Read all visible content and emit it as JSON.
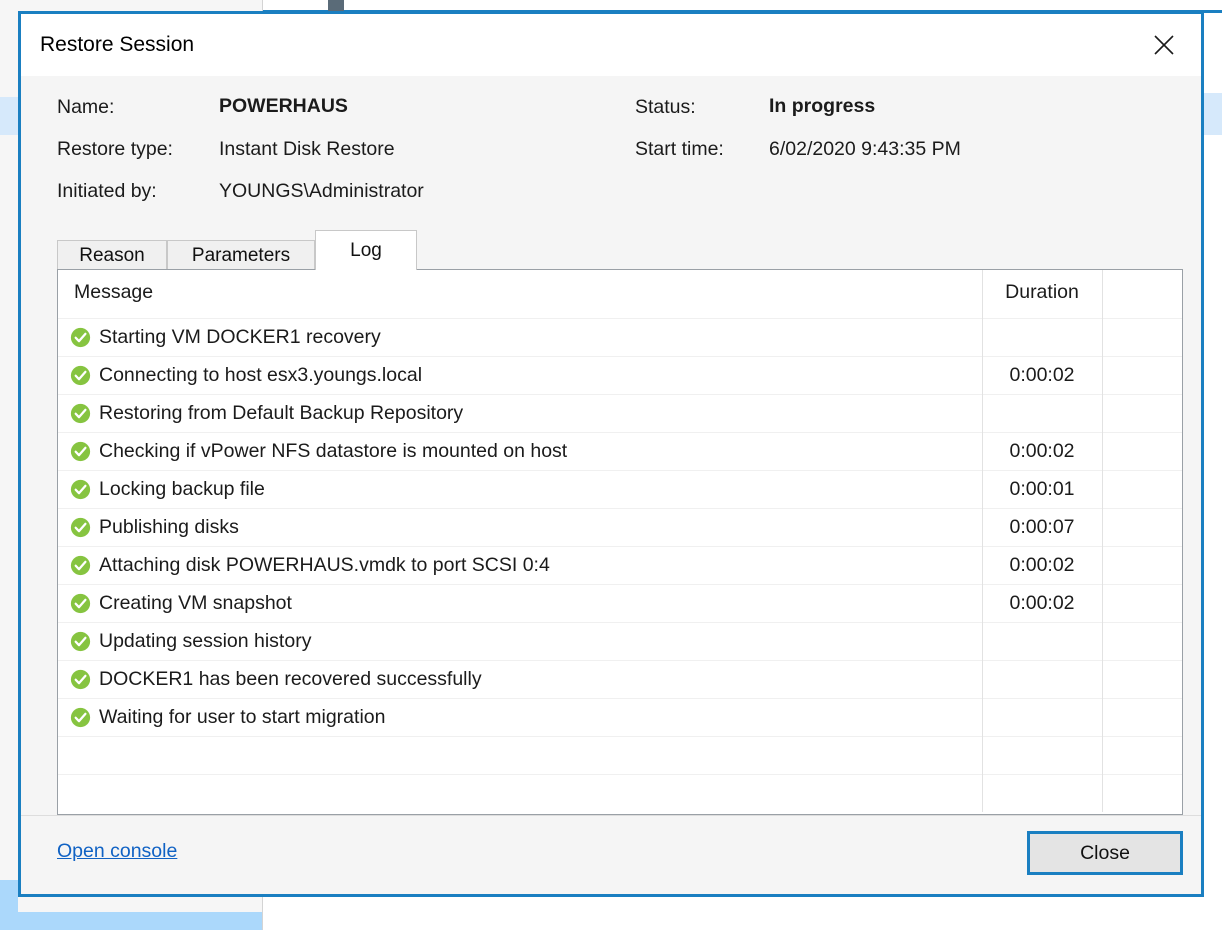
{
  "dialog": {
    "title": "Restore Session",
    "close_icon": "close-icon"
  },
  "summary": {
    "fields": [
      {
        "label": "Name:",
        "value": "POWERHAUS",
        "bold": true
      },
      {
        "label": "Restore type:",
        "value": "Instant Disk Restore",
        "bold": false
      },
      {
        "label": "Initiated by:",
        "value": "YOUNGS\\Administrator",
        "bold": false
      },
      {
        "label": "Status:",
        "value": "In progress",
        "bold": true
      },
      {
        "label": "Start time:",
        "value": "6/02/2020 9:43:35 PM",
        "bold": false
      }
    ]
  },
  "tabs": [
    {
      "label": "Reason",
      "selected": false
    },
    {
      "label": "Parameters",
      "selected": false
    },
    {
      "label": "Log",
      "selected": true
    }
  ],
  "log_grid": {
    "columns": [
      {
        "key": "message",
        "label": "Message"
      },
      {
        "key": "duration",
        "label": "Duration"
      },
      {
        "key": "extra",
        "label": ""
      }
    ],
    "status_icon": "success-check-icon",
    "rows": [
      {
        "message": "Starting VM DOCKER1 recovery",
        "duration": ""
      },
      {
        "message": "Connecting to host esx3.youngs.local",
        "duration": "0:00:02"
      },
      {
        "message": "Restoring from Default Backup Repository",
        "duration": ""
      },
      {
        "message": "Checking if vPower NFS datastore is mounted on host",
        "duration": "0:00:02"
      },
      {
        "message": "Locking backup file",
        "duration": "0:00:01"
      },
      {
        "message": "Publishing disks",
        "duration": "0:00:07"
      },
      {
        "message": "Attaching disk POWERHAUS.vmdk to port SCSI 0:4",
        "duration": "0:00:02"
      },
      {
        "message": "Creating VM snapshot",
        "duration": "0:00:02"
      },
      {
        "message": "Updating session history",
        "duration": ""
      },
      {
        "message": "DOCKER1 has been recovered successfully",
        "duration": ""
      },
      {
        "message": "Waiting for user to start migration",
        "duration": ""
      }
    ],
    "empty_rows": 2
  },
  "footer": {
    "open_console_label": "Open console",
    "close_label": "Close"
  },
  "colors": {
    "accent": "#1a7fc1",
    "link": "#1062c4",
    "success": "#86c440",
    "selection": "#d6e9fb",
    "selection_strong": "#abd8fb"
  }
}
